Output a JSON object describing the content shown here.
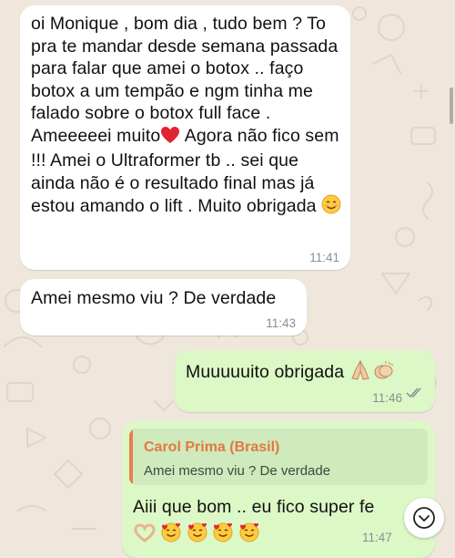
{
  "messages": [
    {
      "direction": "incoming",
      "text": "oi Monique , bom dia , tudo bem ? To pra te mandar desde semana passada para falar que amei o botox .. faço botox a um tempão e ngm tinha me falado sobre o botox full face . Ameeeeei muito",
      "emoji_after_text": "red-heart",
      "text_continued": " Agora não fico sem !!! Amei o Ultraformer tb .. sei que ainda não é o resultado final mas já estou amando o lift . Muito obrigada ",
      "emoji_end": "smiling-face",
      "time": "11:41"
    },
    {
      "direction": "incoming",
      "text": "Amei mesmo viu ? De verdade",
      "time": "11:43"
    },
    {
      "direction": "outgoing",
      "text": "Muuuuuito obrigada ",
      "emojis": [
        "folded-hands",
        "clapping-hands"
      ],
      "time": "11:46",
      "status": "read"
    },
    {
      "direction": "outgoing",
      "reply_to": {
        "author": "Carol Prima (Brasil)",
        "text": "Amei mesmo viu ? De verdade"
      },
      "text": "Aiii que bom .. eu fico super fe",
      "emojis": [
        "heart-hands",
        "smiling-face-with-hearts",
        "smiling-face-with-hearts",
        "smiling-face-with-hearts",
        "smiling-face-with-hearts"
      ],
      "time": "11:47",
      "status": "read"
    }
  ],
  "controls": {
    "scroll_down_icon": "chevron-down-icon"
  },
  "colors": {
    "wallpaper": "#efe7dc",
    "incoming_bubble": "#ffffff",
    "outgoing_bubble": "#dcf8c6",
    "reply_author": "#e4783f",
    "read_ticks": "#8a8f93"
  }
}
